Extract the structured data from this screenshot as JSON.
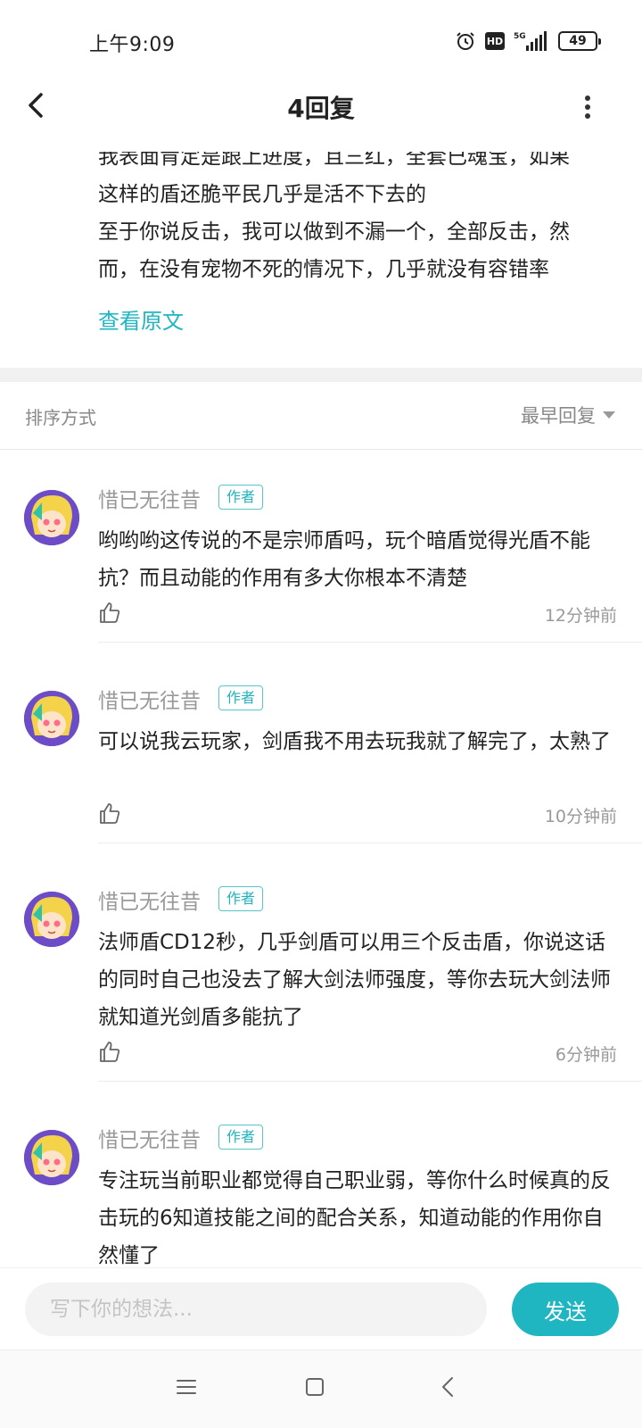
{
  "status_bar": {
    "time": "上午9:09",
    "hd": "HD",
    "network": "5G",
    "battery": "49"
  },
  "header": {
    "title": "4回复"
  },
  "post": {
    "lines": [
      "我表面肯定是跟上进度，且三红，全套已魂宝，如果",
      "这样的盾还脆平民几乎是活不下去的",
      "至于你说反击，我可以做到不漏一个，全部反击，然",
      "而，在没有宠物不死的情况下，几乎就没有容错率"
    ],
    "view_original": "查看原文"
  },
  "sort": {
    "label": "排序方式",
    "value": "最早回复"
  },
  "comments": [
    {
      "username": "惜已无往昔",
      "badge": "作者",
      "text": "哟哟哟这传说的不是宗师盾吗，玩个暗盾觉得光盾不能抗？而且动能的作用有多大你根本不清楚",
      "time": "12分钟前"
    },
    {
      "username": "惜已无往昔",
      "badge": "作者",
      "text": "可以说我云玩家，剑盾我不用去玩我就了解完了，太熟了",
      "time": "10分钟前"
    },
    {
      "username": "惜已无往昔",
      "badge": "作者",
      "text": "法师盾CD12秒，几乎剑盾可以用三个反击盾，你说这话的同时自己也没去了解大剑法师强度，等你去玩大剑法师就知道光剑盾多能抗了",
      "time": "6分钟前"
    },
    {
      "username": "惜已无往昔",
      "badge": "作者",
      "text": "专注玩当前职业都觉得自己职业弱，等你什么时候真的反击玩的6知道技能之间的配合关系，知道动能的作用你自然懂了",
      "time": ""
    }
  ],
  "input": {
    "placeholder": "写下你的想法...",
    "send_label": "发送"
  },
  "colors": {
    "accent": "#1fb6c1",
    "muted_text": "#999999",
    "avatar_bg": "#6c4cc7"
  },
  "icons": {
    "back": "back-arrow-icon",
    "more": "more-vertical-icon",
    "like": "thumbs-up-icon",
    "alarm": "alarm-clock-icon",
    "signal": "signal-icon",
    "nav_menu": "menu-icon",
    "nav_home": "home-square-icon",
    "nav_back": "back-chevron-icon"
  }
}
